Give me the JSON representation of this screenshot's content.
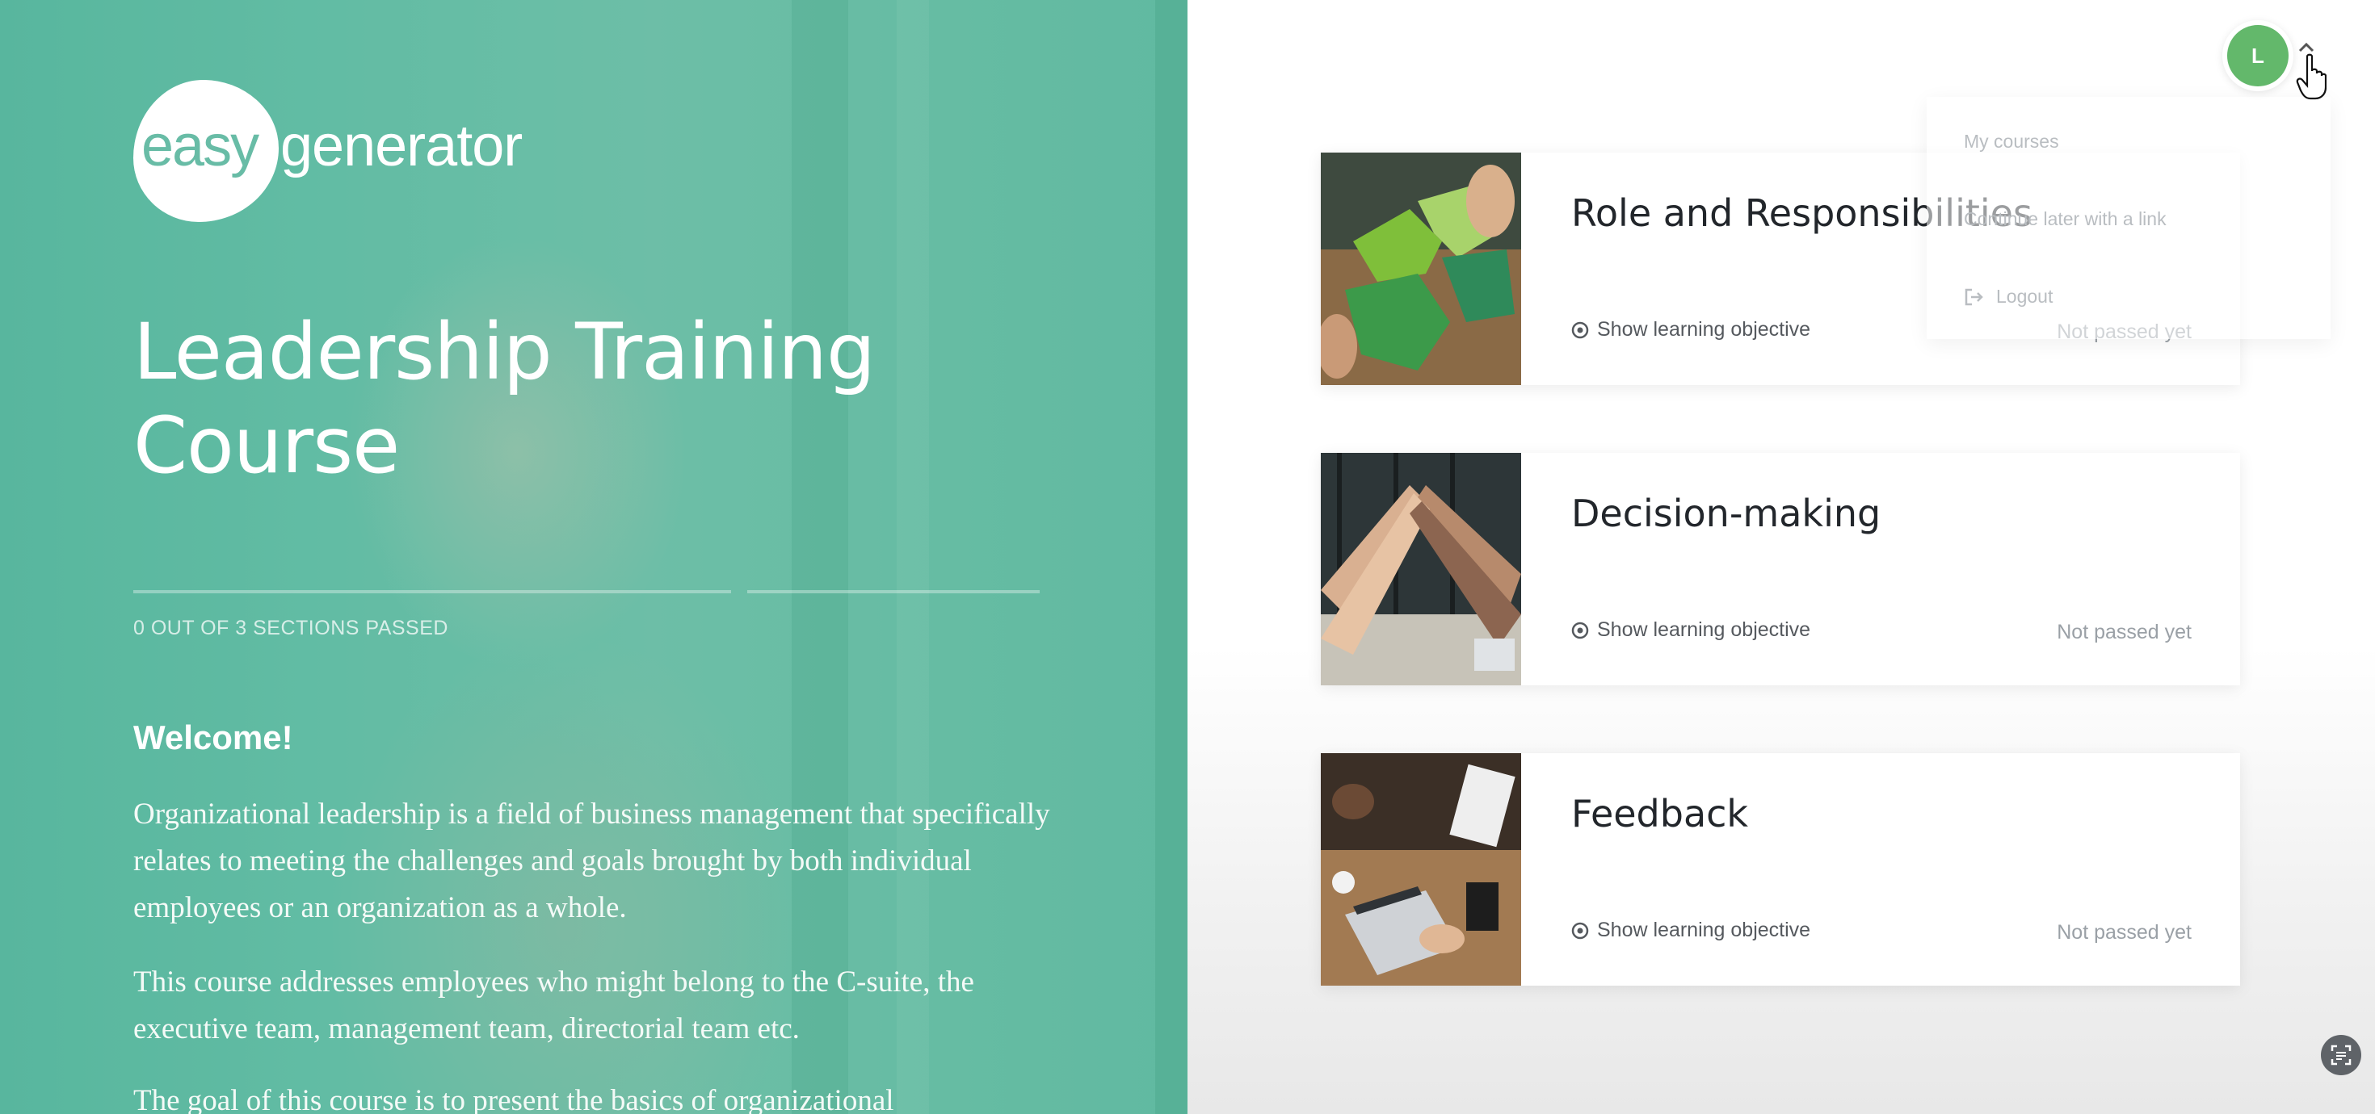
{
  "logo": {
    "part1": "easy",
    "part2": "generator"
  },
  "course": {
    "title": "Leadership Training Course",
    "progress_text": "0 OUT OF 3 SECTIONS PASSED",
    "sections_passed": 0,
    "sections_total": 3
  },
  "intro": {
    "heading": "Welcome!",
    "paragraphs": [
      "Organizational leadership is a field of business management that specifically relates to meeting the challenges and goals brought by both individual employees or an organization as a whole.",
      "This  course addresses employees who might belong to the C-suite, the executive team, management team, directorial team etc.",
      "The goal of this course is to present the basics of organizational"
    ]
  },
  "sections": [
    {
      "title": "Role and Responsibilities",
      "objective_label": "Show learning objective",
      "status": "Not passed yet",
      "image": "puzzle-pieces"
    },
    {
      "title": "Decision-making",
      "objective_label": "Show learning objective",
      "status": "Not passed yet",
      "image": "team-high-five"
    },
    {
      "title": "Feedback",
      "objective_label": "Show learning objective",
      "status": "Not passed yet",
      "image": "laptop-desk"
    }
  ],
  "user_menu": {
    "avatar_initial": "L",
    "avatar_color": "#63b86b",
    "items": [
      "My courses",
      "Continue later with a link",
      "Logout"
    ]
  },
  "colors": {
    "accent": "#5cb8a1",
    "text_dark": "#22262b",
    "status_gray": "#9aa0a6"
  }
}
